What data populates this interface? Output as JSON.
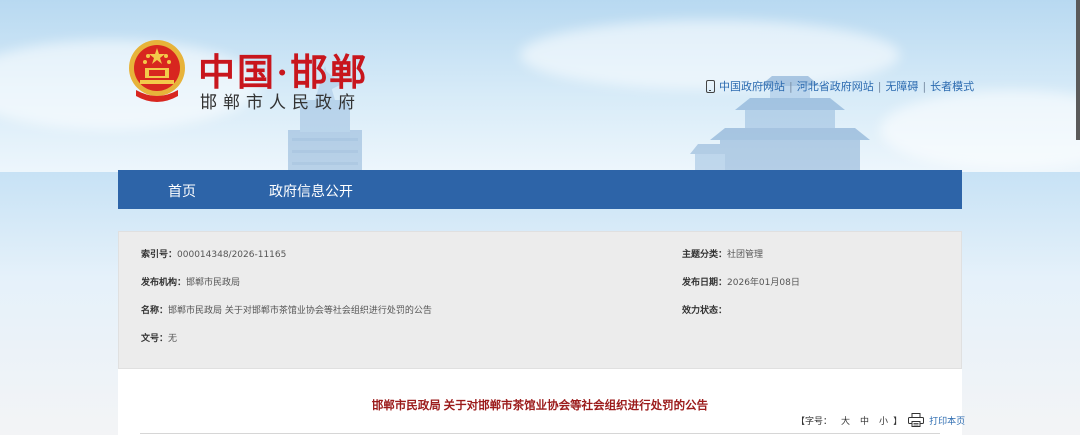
{
  "header": {
    "site_title": "中国·邯郸",
    "site_subtitle": "邯郸市人民政府",
    "emblem_icon": "national-emblem-icon",
    "links": [
      {
        "label": "中国政府网站"
      },
      {
        "label": "河北省政府网站"
      },
      {
        "label": "无障碍"
      },
      {
        "label": "长者模式"
      }
    ],
    "separator": "|"
  },
  "nav": {
    "items": [
      {
        "label": "首页"
      },
      {
        "label": "政府信息公开"
      }
    ]
  },
  "meta": {
    "index_no_label": "索引号：",
    "index_no": "000014348/2026-11165",
    "topic_label": "主题分类：",
    "topic": "社团管理",
    "publisher_label": "发布机构：",
    "publisher": "邯郸市民政局",
    "date_label": "发布日期：",
    "date": "2026年01月08日",
    "name_label": "名称：",
    "name": "邯郸市民政局 关于对邯郸市茶馆业协会等社会组织进行处罚的公告",
    "status_label": "效力状态：",
    "status": "",
    "doc_no_label": "文号：",
    "doc_no": "无"
  },
  "article": {
    "title": "邯郸市民政局 关于对邯郸市茶馆业协会等社会组织进行处罚的公告",
    "font_label": "【字号：",
    "size_large": "大",
    "size_medium": "中",
    "size_small": "小",
    "font_close": "】",
    "print_label": "打印本页"
  },
  "colors": {
    "nav_bg": "#2d64a8",
    "title_red": "#c8161d",
    "article_title": "#9b1b1b",
    "link_blue": "#2c6bb0"
  }
}
